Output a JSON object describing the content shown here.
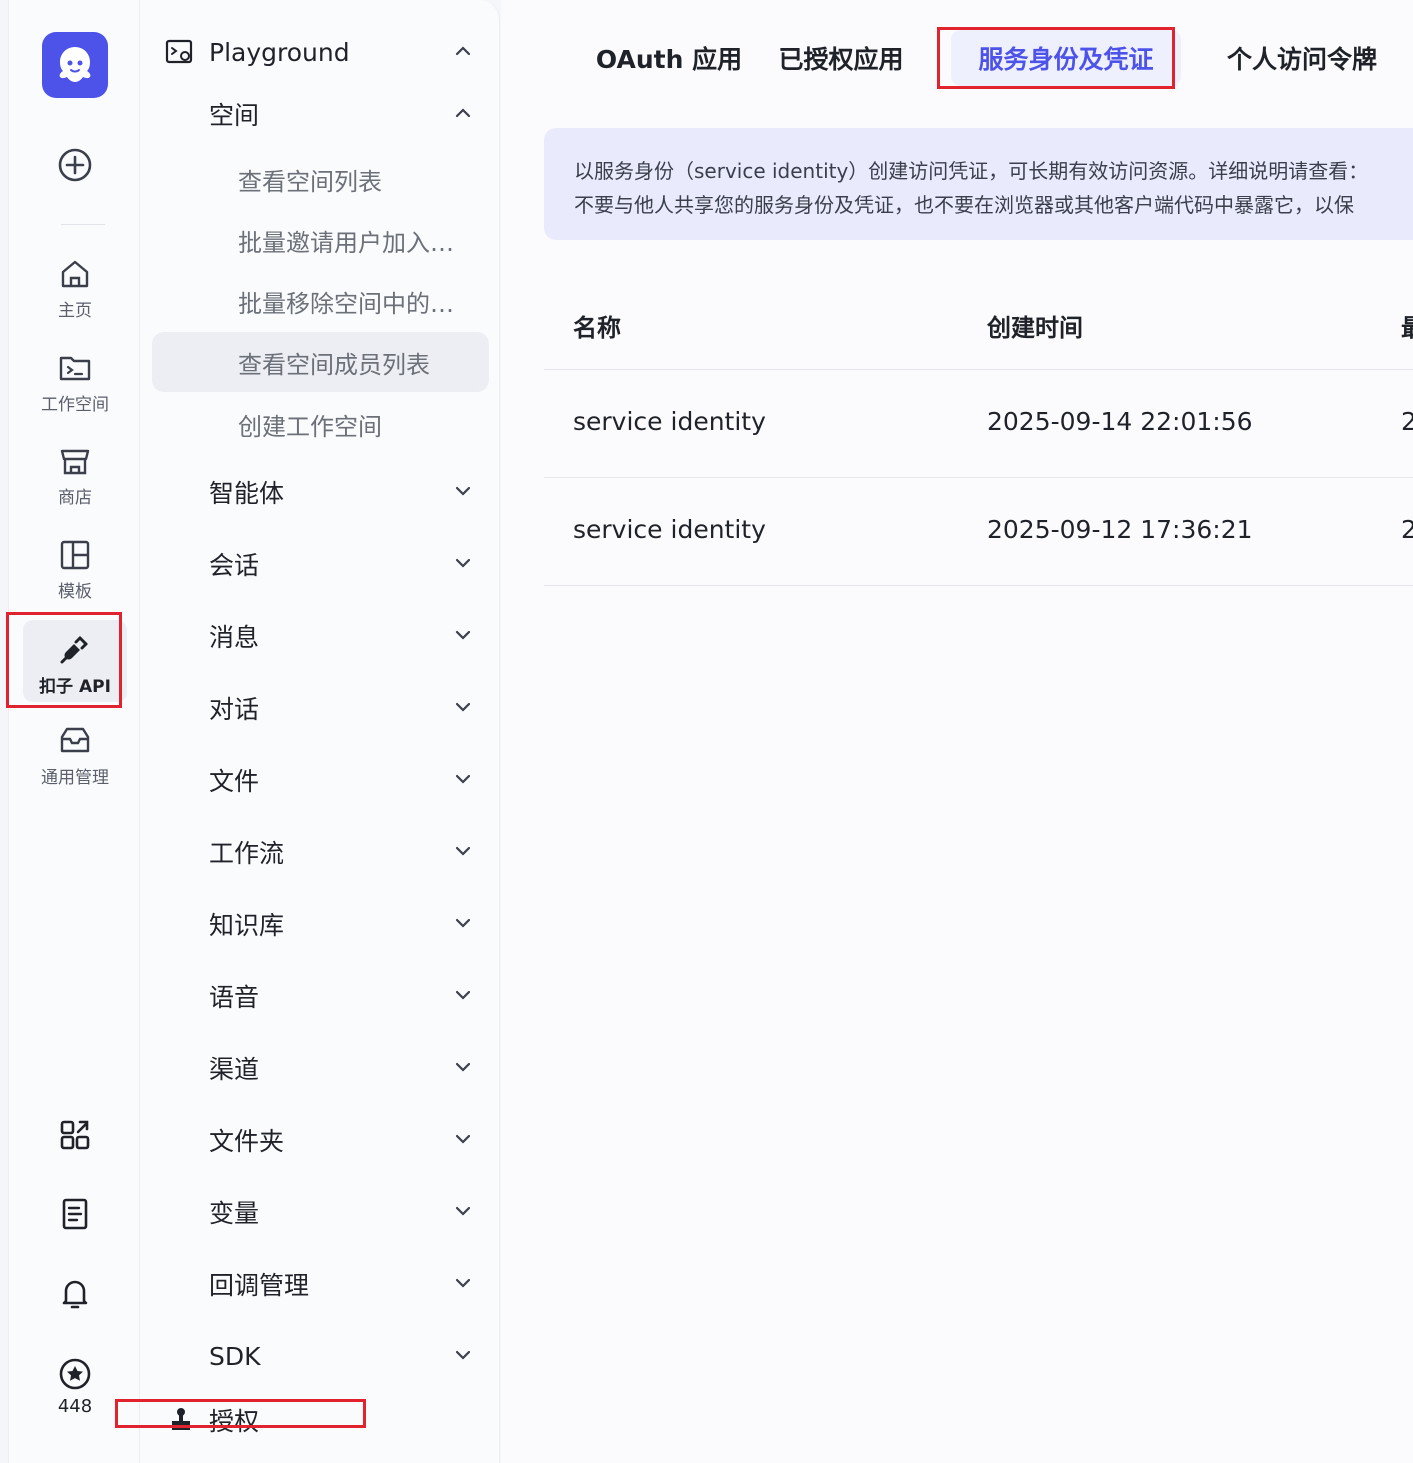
{
  "rail": {
    "items": [
      {
        "label": "主页",
        "icon": "home-icon"
      },
      {
        "label": "工作空间",
        "icon": "terminal-icon"
      },
      {
        "label": "商店",
        "icon": "store-icon"
      },
      {
        "label": "模板",
        "icon": "template-icon"
      },
      {
        "label": "扣子 API",
        "icon": "plug-icon"
      },
      {
        "label": "通用管理",
        "icon": "inbox-icon"
      }
    ],
    "points": "448"
  },
  "nav": {
    "playground": "Playground",
    "space": "空间",
    "space_children": [
      "查看空间列表",
      "批量邀请用户加入…",
      "批量移除空间中的…",
      "查看空间成员列表",
      "创建工作空间"
    ],
    "sections": [
      "智能体",
      "会话",
      "消息",
      "对话",
      "文件",
      "工作流",
      "知识库",
      "语音",
      "渠道",
      "文件夹",
      "变量",
      "回调管理",
      "SDK"
    ],
    "auth": "授权"
  },
  "tabs": [
    "OAuth 应用",
    "已授权应用",
    "服务身份及凭证",
    "个人访问令牌"
  ],
  "info": {
    "line1": "以服务身份（service identity）创建访问凭证，可长期有效访问资源。详细说明请查看：",
    "line2": "不要与他人共享您的服务身份及凭证，也不要在浏览器或其他客户端代码中暴露它，以保"
  },
  "table": {
    "headers": [
      "名称",
      "创建时间",
      "最"
    ],
    "rows": [
      {
        "name": "service identity",
        "created": "2025-09-14 22:01:56",
        "extra": "2"
      },
      {
        "name": "service identity",
        "created": "2025-09-12 17:36:21",
        "extra": "2"
      }
    ]
  },
  "colors": {
    "accent": "#4d53e8",
    "highlight": "#e0232e"
  }
}
